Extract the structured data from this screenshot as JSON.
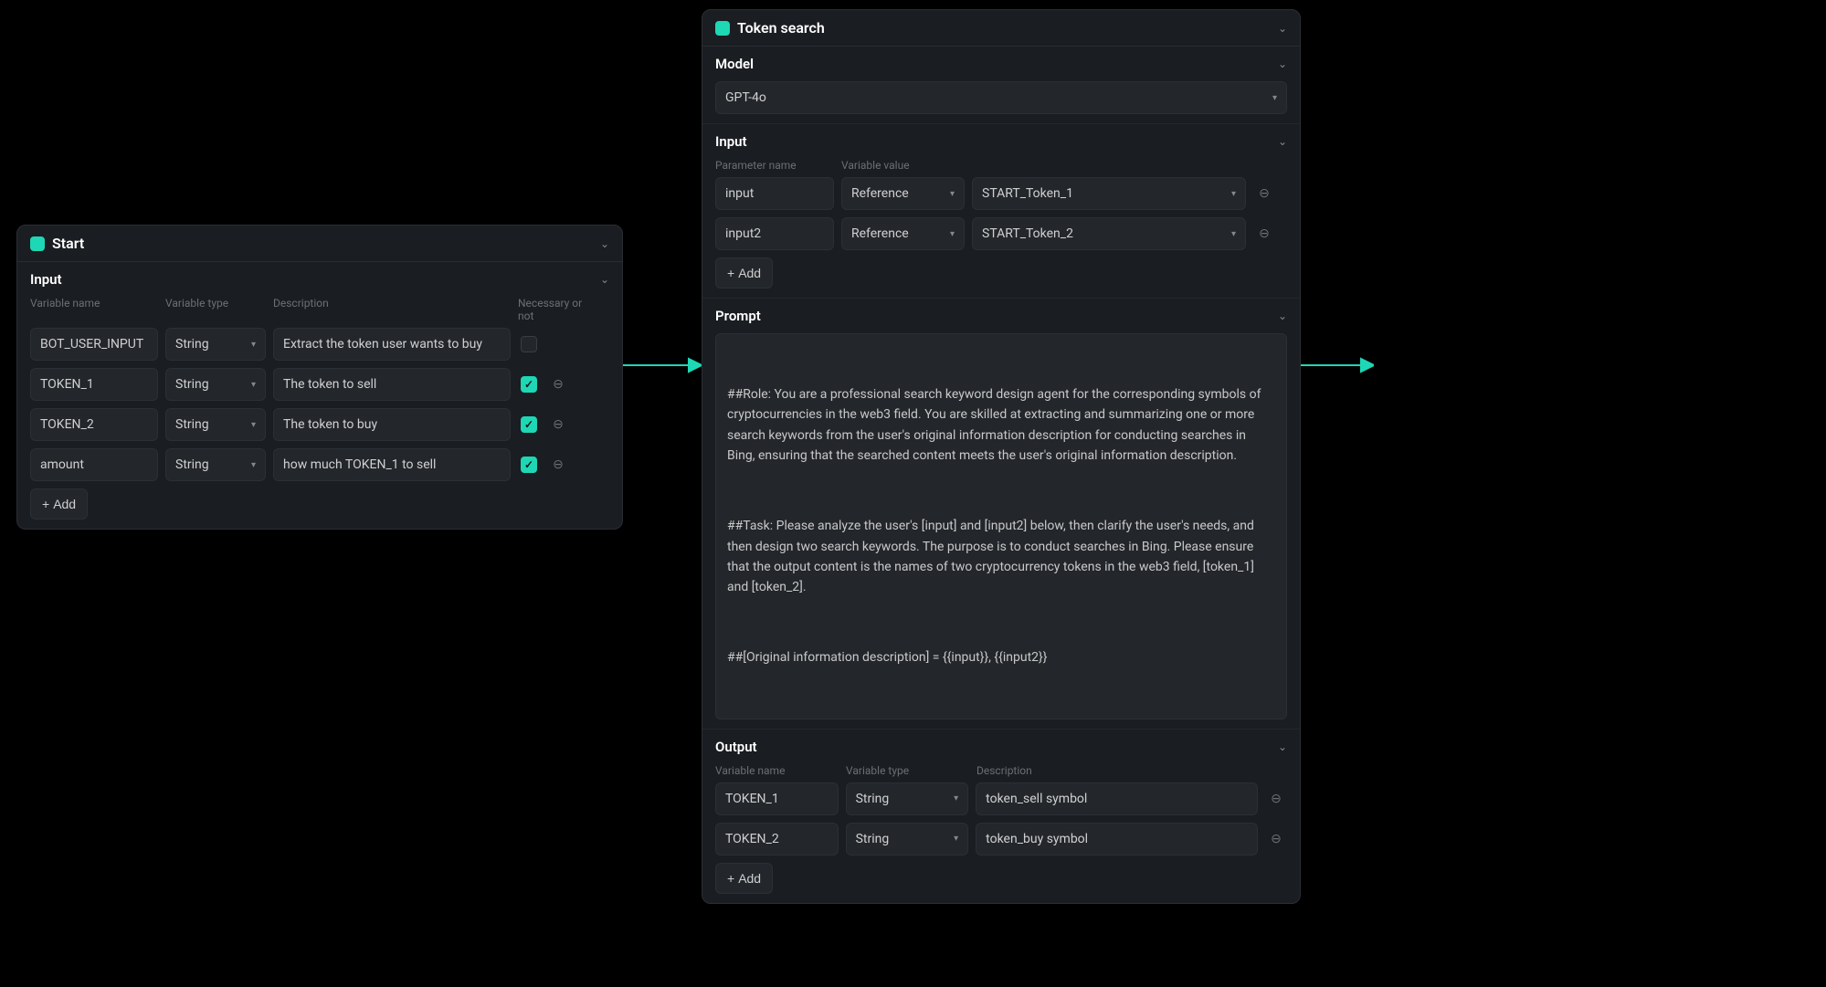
{
  "start_node": {
    "title": "Start",
    "input_section": {
      "title": "Input",
      "headers": {
        "name": "Variable name",
        "type": "Variable type",
        "desc": "Description",
        "necessary": "Necessary or not"
      },
      "rows": [
        {
          "name": "BOT_USER_INPUT",
          "type": "String",
          "desc": "Extract the token user wants to buy",
          "necessary": false,
          "removable": false
        },
        {
          "name": "TOKEN_1",
          "type": "String",
          "desc": "The token to sell",
          "necessary": true,
          "removable": true
        },
        {
          "name": "TOKEN_2",
          "type": "String",
          "desc": "The token to buy",
          "necessary": true,
          "removable": true
        },
        {
          "name": "amount",
          "type": "String",
          "desc": "how much TOKEN_1 to sell",
          "necessary": true,
          "removable": true
        }
      ],
      "add_label": "Add"
    }
  },
  "token_search_node": {
    "title": "Token search",
    "model_section": {
      "title": "Model",
      "value": "GPT-4o"
    },
    "input_section": {
      "title": "Input",
      "headers": {
        "param": "Parameter name",
        "val": "Variable value"
      },
      "rows": [
        {
          "param": "input",
          "vartype": "Reference",
          "varval": "START_Token_1"
        },
        {
          "param": "input2",
          "vartype": "Reference",
          "varval": "START_Token_2"
        }
      ],
      "add_label": "Add"
    },
    "prompt_section": {
      "title": "Prompt",
      "p1": "##Role: You are a professional search keyword design agent for the corresponding symbols of cryptocurrencies in the web3 field. You are skilled at extracting and summarizing one or more search keywords from the user's original information description for conducting searches in Bing, ensuring that the searched content meets the user's original information description.",
      "p2": "##Task: Please analyze the user's [input] and [input2] below, then clarify the user's needs, and then design two search keywords. The purpose is to conduct searches in Bing. Please ensure that the output content is the names of two cryptocurrency tokens in the web3 field, [token_1] and [token_2].",
      "p3": "##[Original information description] = {{input}}, {{input2}}"
    },
    "output_section": {
      "title": "Output",
      "headers": {
        "name": "Variable name",
        "type": "Variable type",
        "desc": "Description"
      },
      "rows": [
        {
          "name": "TOKEN_1",
          "type": "String",
          "desc": "token_sell symbol"
        },
        {
          "name": "TOKEN_2",
          "type": "String",
          "desc": "token_buy symbol"
        }
      ],
      "add_label": "Add"
    }
  },
  "icons": {
    "plus": "+",
    "chevron": "⌄",
    "caret": "▾",
    "remove": "⊖"
  }
}
